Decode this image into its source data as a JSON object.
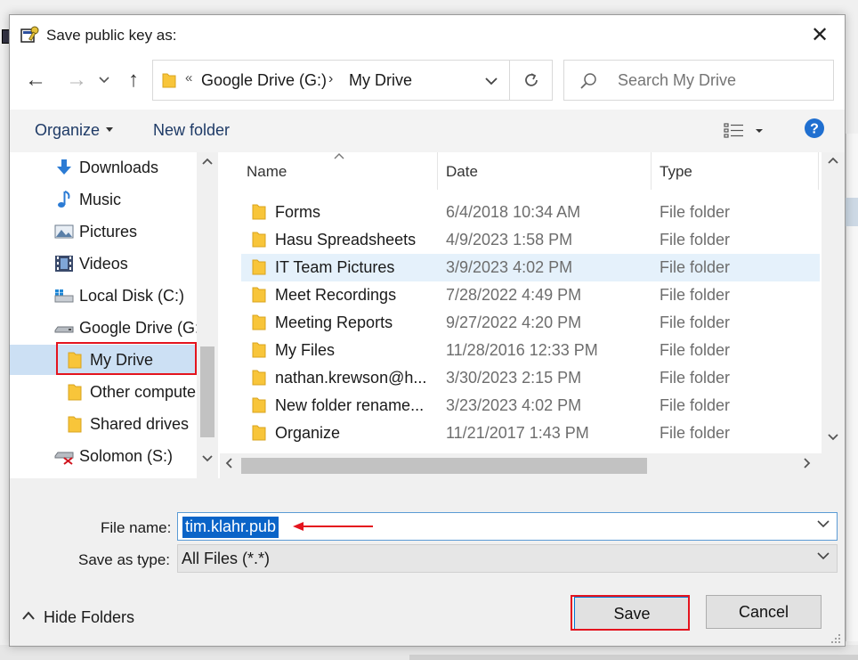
{
  "window": {
    "title": "Save public key as:",
    "close_glyph": "✕"
  },
  "nav": {
    "back_glyph": "←",
    "forward_glyph": "→",
    "recent_glyph": "⌄",
    "up_glyph": "↑"
  },
  "address": {
    "overflow_glyph": "«",
    "path": [
      "Google Drive (G:)",
      "My Drive"
    ],
    "separator_glyph": "›"
  },
  "search": {
    "placeholder": "Search My Drive"
  },
  "toolbar": {
    "organize_label": "Organize",
    "new_folder_label": "New folder"
  },
  "navpane": {
    "items": [
      {
        "label": "Downloads",
        "icon": "downloads-icon"
      },
      {
        "label": "Music",
        "icon": "music-icon"
      },
      {
        "label": "Pictures",
        "icon": "pictures-icon"
      },
      {
        "label": "Videos",
        "icon": "videos-icon"
      },
      {
        "label": "Local Disk (C:)",
        "icon": "local-disk-icon"
      },
      {
        "label": "Google Drive (G:",
        "icon": "drive-icon"
      },
      {
        "label": "My Drive",
        "icon": "folder-icon",
        "selected": true
      },
      {
        "label": "Other compute",
        "icon": "folder-icon"
      },
      {
        "label": "Shared drives",
        "icon": "folder-icon"
      },
      {
        "label": "Solomon (S:)",
        "icon": "network-drive-icon"
      }
    ]
  },
  "filelist": {
    "columns": {
      "name": "Name",
      "date": "Date",
      "type": "Type"
    },
    "rows": [
      {
        "name": "Forms",
        "date": "6/4/2018 10:34 AM",
        "type": "File folder"
      },
      {
        "name": "Hasu Spreadsheets",
        "date": "4/9/2023 1:58 PM",
        "type": "File folder"
      },
      {
        "name": "IT Team Pictures",
        "date": "3/9/2023 4:02 PM",
        "type": "File folder",
        "selected": true
      },
      {
        "name": "Meet Recordings",
        "date": "7/28/2022 4:49 PM",
        "type": "File folder"
      },
      {
        "name": "Meeting Reports",
        "date": "9/27/2022 4:20 PM",
        "type": "File folder"
      },
      {
        "name": "My Files",
        "date": "11/28/2016 12:33 PM",
        "type": "File folder"
      },
      {
        "name": "nathan.krewson@h...",
        "date": "3/30/2023 2:15 PM",
        "type": "File folder"
      },
      {
        "name": "New folder rename...",
        "date": "3/23/2023 4:02 PM",
        "type": "File folder"
      },
      {
        "name": "Organize",
        "date": "11/21/2017 1:43 PM",
        "type": "File folder"
      }
    ]
  },
  "form": {
    "file_name_label": "File name:",
    "file_name_value": "tim.klahr.pub",
    "save_as_type_label": "Save as type:",
    "save_as_type_value": "All Files (*.*)"
  },
  "footer": {
    "hide_folders_label": "Hide Folders",
    "save_label": "Save",
    "cancel_label": "Cancel"
  },
  "colors": {
    "accent": "#0078d7",
    "annotation_red": "#e4141e",
    "folder_yellow": "#f8c53a",
    "selection": "#cce0f4",
    "help_blue": "#1f6fd0"
  }
}
